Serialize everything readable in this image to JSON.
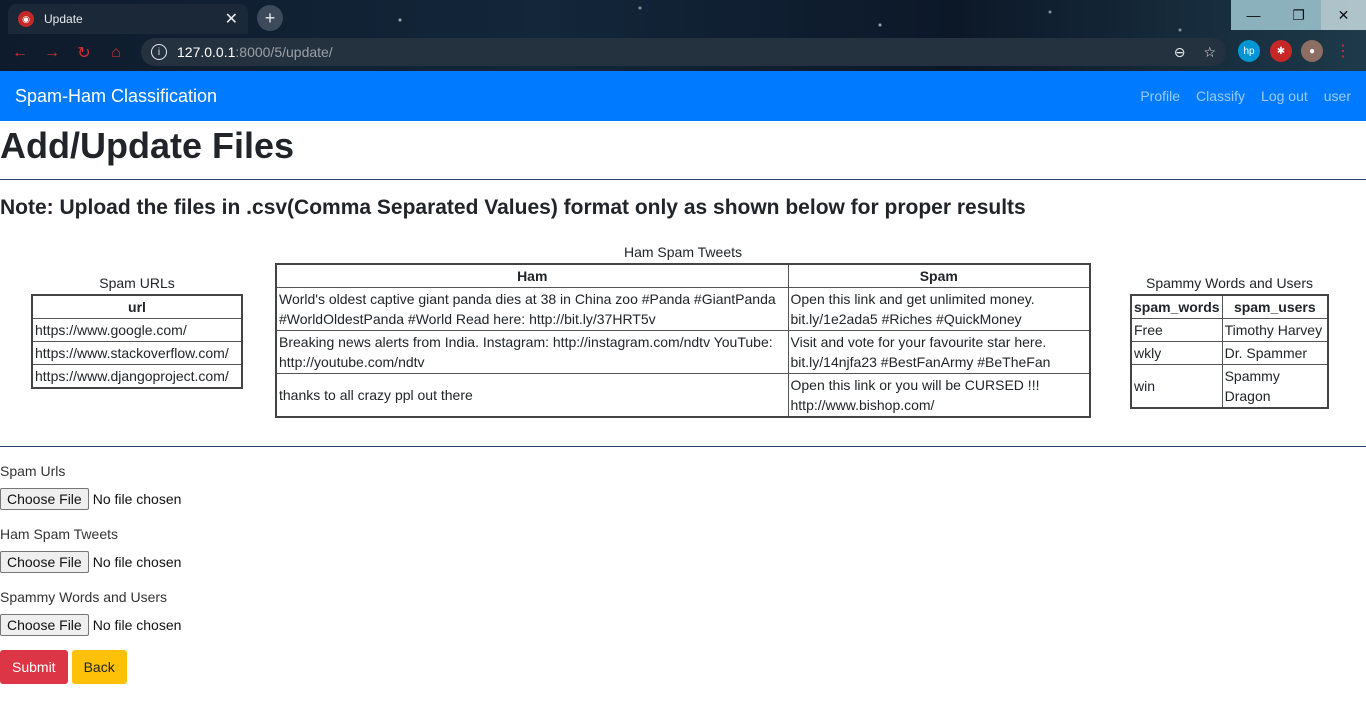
{
  "browser": {
    "tab_title": "Update",
    "url_host": "127.0.0.1",
    "url_path": ":8000/5/update/"
  },
  "navbar": {
    "brand": "Spam-Ham Classification",
    "links": [
      "Profile",
      "Classify",
      "Log out",
      "user"
    ]
  },
  "page": {
    "title": "Add/Update Files",
    "note": "Note: Upload the files in .csv(Comma Separated Values) format only as shown below for proper results"
  },
  "tables": {
    "spam_urls": {
      "caption": "Spam URLs",
      "headers": [
        "url"
      ],
      "rows": [
        [
          "https://www.google.com/"
        ],
        [
          "https://www.stackoverflow.com/"
        ],
        [
          "https://www.djangoproject.com/"
        ]
      ]
    },
    "ham_spam": {
      "caption": "Ham Spam Tweets",
      "headers": [
        "Ham",
        "Spam"
      ],
      "rows": [
        [
          "World's oldest captive giant panda dies at 38 in China zoo #Panda #GiantPanda #WorldOldestPanda #World Read here: http://bit.ly/37HRT5v",
          "Open this link and get unlimited money. bit.ly/1e2ada5 #Riches #QuickMoney"
        ],
        [
          "Breaking news alerts from India. Instagram: http://instagram.com/ndtv YouTube: http://youtube.com/ndtv",
          "Visit and vote for your favourite star here. bit.ly/14njfa23 #BestFanArmy #BeTheFan"
        ],
        [
          "thanks to all crazy ppl out there",
          "Open this link or you will be CURSED !!! http://www.bishop.com/"
        ]
      ]
    },
    "spammy_words": {
      "caption": "Spammy Words and Users",
      "headers": [
        "spam_words",
        "spam_users"
      ],
      "rows": [
        [
          "Free",
          "Timothy Harvey"
        ],
        [
          "wkly",
          "Dr. Spammer"
        ],
        [
          "win",
          "Spammy Dragon"
        ]
      ]
    }
  },
  "form": {
    "fields": [
      {
        "label": "Spam Urls",
        "button": "Choose File",
        "status": "No file chosen"
      },
      {
        "label": "Ham Spam Tweets",
        "button": "Choose File",
        "status": "No file chosen"
      },
      {
        "label": "Spammy Words and Users",
        "button": "Choose File",
        "status": "No file chosen"
      }
    ],
    "submit": "Submit",
    "back": "Back"
  },
  "colors": {
    "navbar": "#007bff",
    "submit": "#dc3545",
    "back": "#ffc107"
  }
}
